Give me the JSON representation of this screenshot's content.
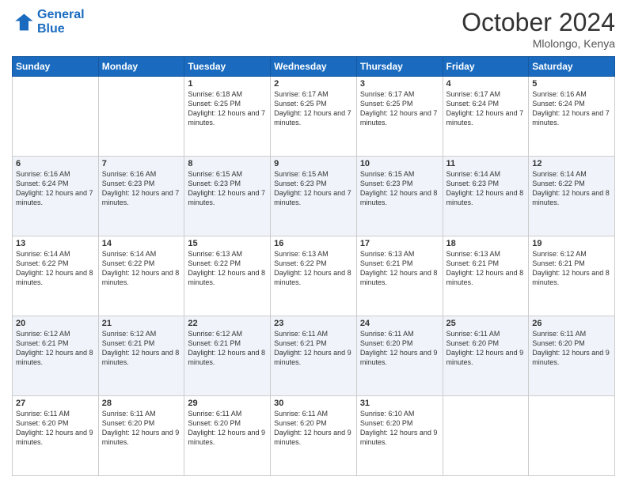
{
  "header": {
    "logo_line1": "General",
    "logo_line2": "Blue",
    "month": "October 2024",
    "location": "Mlolongo, Kenya"
  },
  "weekdays": [
    "Sunday",
    "Monday",
    "Tuesday",
    "Wednesday",
    "Thursday",
    "Friday",
    "Saturday"
  ],
  "weeks": [
    [
      null,
      null,
      {
        "day": "1",
        "sunrise": "6:18 AM",
        "sunset": "6:25 PM",
        "daylight": "12 hours and 7 minutes."
      },
      {
        "day": "2",
        "sunrise": "6:17 AM",
        "sunset": "6:25 PM",
        "daylight": "12 hours and 7 minutes."
      },
      {
        "day": "3",
        "sunrise": "6:17 AM",
        "sunset": "6:25 PM",
        "daylight": "12 hours and 7 minutes."
      },
      {
        "day": "4",
        "sunrise": "6:17 AM",
        "sunset": "6:24 PM",
        "daylight": "12 hours and 7 minutes."
      },
      {
        "day": "5",
        "sunrise": "6:16 AM",
        "sunset": "6:24 PM",
        "daylight": "12 hours and 7 minutes."
      }
    ],
    [
      {
        "day": "6",
        "sunrise": "6:16 AM",
        "sunset": "6:24 PM",
        "daylight": "12 hours and 7 minutes."
      },
      {
        "day": "7",
        "sunrise": "6:16 AM",
        "sunset": "6:23 PM",
        "daylight": "12 hours and 7 minutes."
      },
      {
        "day": "8",
        "sunrise": "6:15 AM",
        "sunset": "6:23 PM",
        "daylight": "12 hours and 7 minutes."
      },
      {
        "day": "9",
        "sunrise": "6:15 AM",
        "sunset": "6:23 PM",
        "daylight": "12 hours and 7 minutes."
      },
      {
        "day": "10",
        "sunrise": "6:15 AM",
        "sunset": "6:23 PM",
        "daylight": "12 hours and 8 minutes."
      },
      {
        "day": "11",
        "sunrise": "6:14 AM",
        "sunset": "6:23 PM",
        "daylight": "12 hours and 8 minutes."
      },
      {
        "day": "12",
        "sunrise": "6:14 AM",
        "sunset": "6:22 PM",
        "daylight": "12 hours and 8 minutes."
      }
    ],
    [
      {
        "day": "13",
        "sunrise": "6:14 AM",
        "sunset": "6:22 PM",
        "daylight": "12 hours and 8 minutes."
      },
      {
        "day": "14",
        "sunrise": "6:14 AM",
        "sunset": "6:22 PM",
        "daylight": "12 hours and 8 minutes."
      },
      {
        "day": "15",
        "sunrise": "6:13 AM",
        "sunset": "6:22 PM",
        "daylight": "12 hours and 8 minutes."
      },
      {
        "day": "16",
        "sunrise": "6:13 AM",
        "sunset": "6:22 PM",
        "daylight": "12 hours and 8 minutes."
      },
      {
        "day": "17",
        "sunrise": "6:13 AM",
        "sunset": "6:21 PM",
        "daylight": "12 hours and 8 minutes."
      },
      {
        "day": "18",
        "sunrise": "6:13 AM",
        "sunset": "6:21 PM",
        "daylight": "12 hours and 8 minutes."
      },
      {
        "day": "19",
        "sunrise": "6:12 AM",
        "sunset": "6:21 PM",
        "daylight": "12 hours and 8 minutes."
      }
    ],
    [
      {
        "day": "20",
        "sunrise": "6:12 AM",
        "sunset": "6:21 PM",
        "daylight": "12 hours and 8 minutes."
      },
      {
        "day": "21",
        "sunrise": "6:12 AM",
        "sunset": "6:21 PM",
        "daylight": "12 hours and 8 minutes."
      },
      {
        "day": "22",
        "sunrise": "6:12 AM",
        "sunset": "6:21 PM",
        "daylight": "12 hours and 8 minutes."
      },
      {
        "day": "23",
        "sunrise": "6:11 AM",
        "sunset": "6:21 PM",
        "daylight": "12 hours and 9 minutes."
      },
      {
        "day": "24",
        "sunrise": "6:11 AM",
        "sunset": "6:20 PM",
        "daylight": "12 hours and 9 minutes."
      },
      {
        "day": "25",
        "sunrise": "6:11 AM",
        "sunset": "6:20 PM",
        "daylight": "12 hours and 9 minutes."
      },
      {
        "day": "26",
        "sunrise": "6:11 AM",
        "sunset": "6:20 PM",
        "daylight": "12 hours and 9 minutes."
      }
    ],
    [
      {
        "day": "27",
        "sunrise": "6:11 AM",
        "sunset": "6:20 PM",
        "daylight": "12 hours and 9 minutes."
      },
      {
        "day": "28",
        "sunrise": "6:11 AM",
        "sunset": "6:20 PM",
        "daylight": "12 hours and 9 minutes."
      },
      {
        "day": "29",
        "sunrise": "6:11 AM",
        "sunset": "6:20 PM",
        "daylight": "12 hours and 9 minutes."
      },
      {
        "day": "30",
        "sunrise": "6:11 AM",
        "sunset": "6:20 PM",
        "daylight": "12 hours and 9 minutes."
      },
      {
        "day": "31",
        "sunrise": "6:10 AM",
        "sunset": "6:20 PM",
        "daylight": "12 hours and 9 minutes."
      },
      null,
      null
    ]
  ]
}
